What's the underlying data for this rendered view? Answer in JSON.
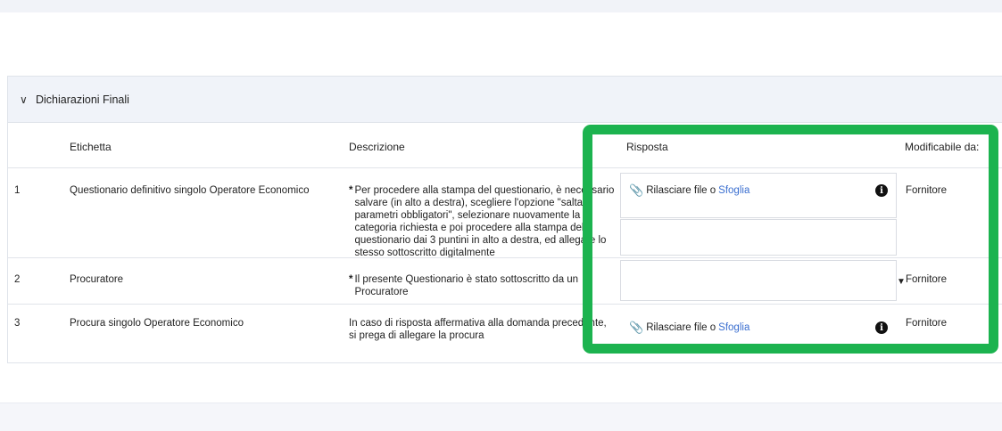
{
  "section": {
    "title": "Dichiarazioni Finali",
    "chevron_icon": "chevron-down-icon"
  },
  "columns": {
    "etichetta": "Etichetta",
    "descrizione": "Descrizione",
    "risposta": "Risposta",
    "modificabile": "Modificabile da:"
  },
  "rows": [
    {
      "num": "1",
      "etichetta": "Questionario definitivo singolo Operatore Economico",
      "star": "*",
      "descrizione": "Per procedere alla stampa del questionario, è necessario salvare (in alto a destra), scegliere l'opzione \"salta parametri obbligatori\", selezionare nuovamente la categoria richiesta e poi procedere alla stampa del questionario dai 3 puntini in alto a destra, ed allegare lo stesso sottoscritto digitalmente",
      "attach_label": "Rilasciare file o",
      "attach_link": "Sfoglia",
      "modificabile": "Fornitore"
    },
    {
      "num": "2",
      "etichetta": "Procuratore",
      "star": "*",
      "descrizione": "Il presente Questionario è stato sottoscritto da un Procuratore",
      "select_value": "",
      "modificabile": "Fornitore"
    },
    {
      "num": "3",
      "etichetta": "Procura singolo Operatore Economico",
      "descrizione": "In caso di risposta affermativa alla domanda precedente, si prega di allegare la procura",
      "attach_label": "Rilasciare file o",
      "attach_link": "Sfoglia",
      "modificabile": "Fornitore"
    }
  ],
  "colors": {
    "highlight": "#1cb34f",
    "link": "#3b6fd0",
    "header_bg": "#f0f3f9"
  }
}
